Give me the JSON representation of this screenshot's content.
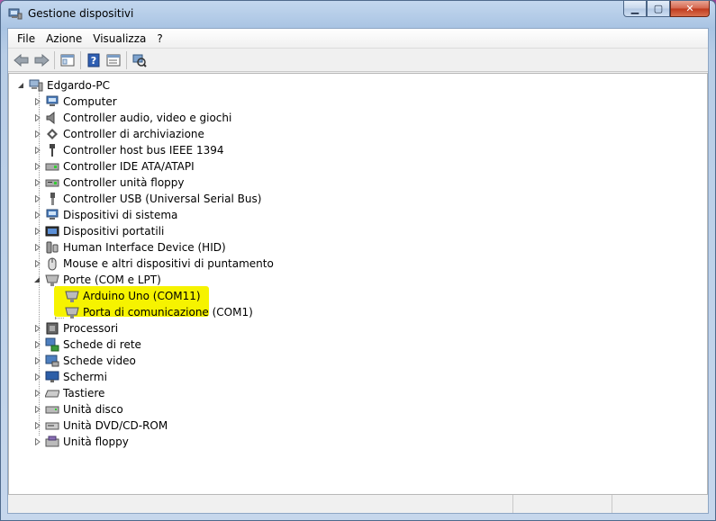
{
  "window": {
    "title": "Gestione dispositivi"
  },
  "caption": {
    "minimize": "▁",
    "maximize": "▢",
    "close": "✕"
  },
  "menu": [
    "File",
    "Azione",
    "Visualizza",
    "?"
  ],
  "tree": {
    "root": "Edgardo-PC",
    "categories": [
      {
        "label": "Computer",
        "icon": "computer-icon"
      },
      {
        "label": "Controller audio, video e giochi",
        "icon": "speaker-icon"
      },
      {
        "label": "Controller di archiviazione",
        "icon": "storage-icon"
      },
      {
        "label": "Controller host bus IEEE 1394",
        "icon": "firewire-icon"
      },
      {
        "label": "Controller IDE ATA/ATAPI",
        "icon": "ide-icon"
      },
      {
        "label": "Controller unità floppy",
        "icon": "floppy-controller-icon"
      },
      {
        "label": "Controller USB (Universal Serial Bus)",
        "icon": "usb-icon"
      },
      {
        "label": "Dispositivi di sistema",
        "icon": "system-device-icon"
      },
      {
        "label": "Dispositivi portatili",
        "icon": "portable-device-icon"
      },
      {
        "label": "Human Interface Device (HID)",
        "icon": "hid-icon"
      },
      {
        "label": "Mouse e altri dispositivi di puntamento",
        "icon": "mouse-icon"
      },
      {
        "label": "Porte (COM e LPT)",
        "icon": "port-icon",
        "expanded": true,
        "children": [
          {
            "label": "Arduino Uno (COM11)",
            "icon": "port-icon"
          },
          {
            "label": "Porta di comunicazione (COM1)",
            "icon": "port-icon"
          }
        ]
      },
      {
        "label": "Processori",
        "icon": "processor-icon"
      },
      {
        "label": "Schede di rete",
        "icon": "network-icon"
      },
      {
        "label": "Schede video",
        "icon": "display-adapter-icon"
      },
      {
        "label": "Schermi",
        "icon": "monitor-icon"
      },
      {
        "label": "Tastiere",
        "icon": "keyboard-icon"
      },
      {
        "label": "Unità disco",
        "icon": "disk-drive-icon"
      },
      {
        "label": "Unità DVD/CD-ROM",
        "icon": "dvd-icon"
      },
      {
        "label": "Unità floppy",
        "icon": "floppy-drive-icon"
      }
    ]
  },
  "colors": {
    "highlight": "#f6f300",
    "titlebar": "#b8cde6"
  }
}
